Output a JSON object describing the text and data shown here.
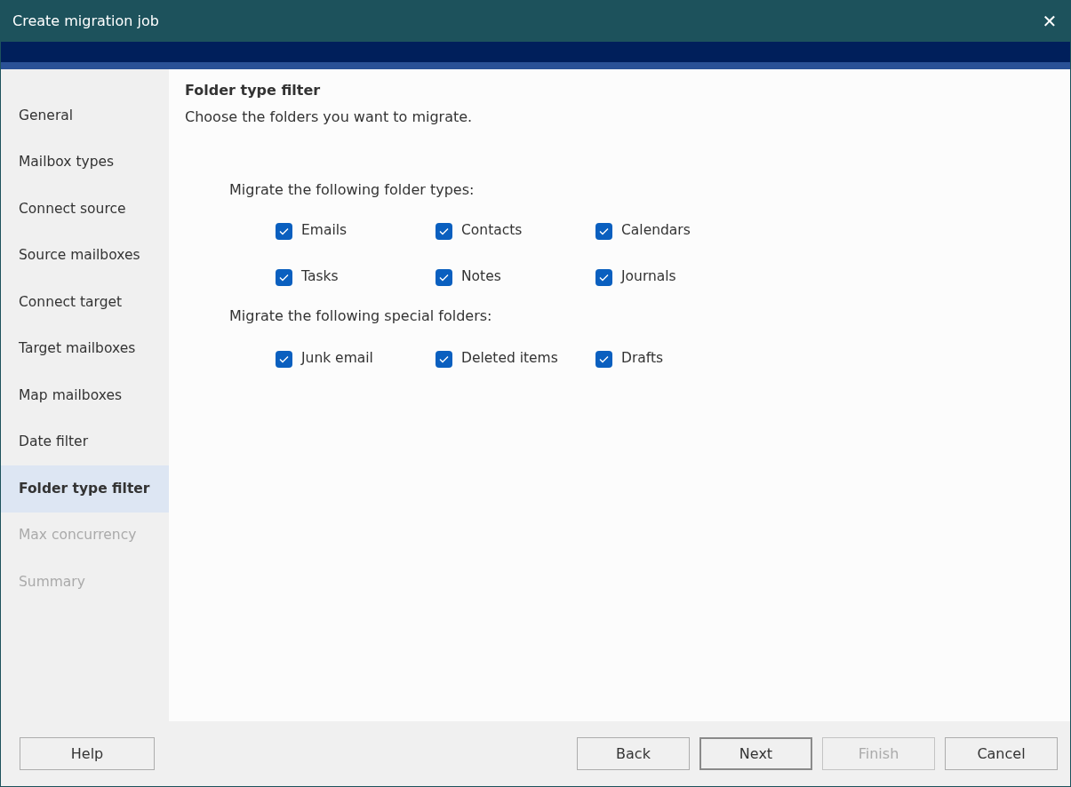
{
  "window": {
    "title": "Create migration job",
    "close": "✕"
  },
  "sidebar": {
    "items": [
      {
        "label": "General",
        "selected": false,
        "disabled": false
      },
      {
        "label": "Mailbox types",
        "selected": false,
        "disabled": false
      },
      {
        "label": "Connect source",
        "selected": false,
        "disabled": false
      },
      {
        "label": "Source mailboxes",
        "selected": false,
        "disabled": false
      },
      {
        "label": "Connect target",
        "selected": false,
        "disabled": false
      },
      {
        "label": "Target mailboxes",
        "selected": false,
        "disabled": false
      },
      {
        "label": "Map mailboxes",
        "selected": false,
        "disabled": false
      },
      {
        "label": "Date filter",
        "selected": false,
        "disabled": false
      },
      {
        "label": "Folder type filter",
        "selected": true,
        "disabled": false
      },
      {
        "label": "Max concurrency",
        "selected": false,
        "disabled": true
      },
      {
        "label": "Summary",
        "selected": false,
        "disabled": true
      }
    ]
  },
  "page": {
    "title": "Folder type filter",
    "subtitle": "Choose the folders you want to migrate.",
    "groups": [
      {
        "heading": "Migrate the following folder types:",
        "options": [
          {
            "label": "Emails",
            "checked": true
          },
          {
            "label": "Contacts",
            "checked": true
          },
          {
            "label": "Calendars",
            "checked": true
          },
          {
            "label": "Tasks",
            "checked": true
          },
          {
            "label": "Notes",
            "checked": true
          },
          {
            "label": "Journals",
            "checked": true
          }
        ]
      },
      {
        "heading": "Migrate the following special folders:",
        "options": [
          {
            "label": "Junk email",
            "checked": true
          },
          {
            "label": "Deleted items",
            "checked": true
          },
          {
            "label": "Drafts",
            "checked": true
          }
        ]
      }
    ]
  },
  "footer": {
    "left_buttons": [
      {
        "label": "Help",
        "default": false,
        "disabled": false
      }
    ],
    "right_buttons": [
      {
        "label": "Back",
        "default": false,
        "disabled": false
      },
      {
        "label": "Next",
        "default": true,
        "disabled": false
      },
      {
        "label": "Finish",
        "default": false,
        "disabled": true
      },
      {
        "label": "Cancel",
        "default": false,
        "disabled": false
      }
    ]
  }
}
